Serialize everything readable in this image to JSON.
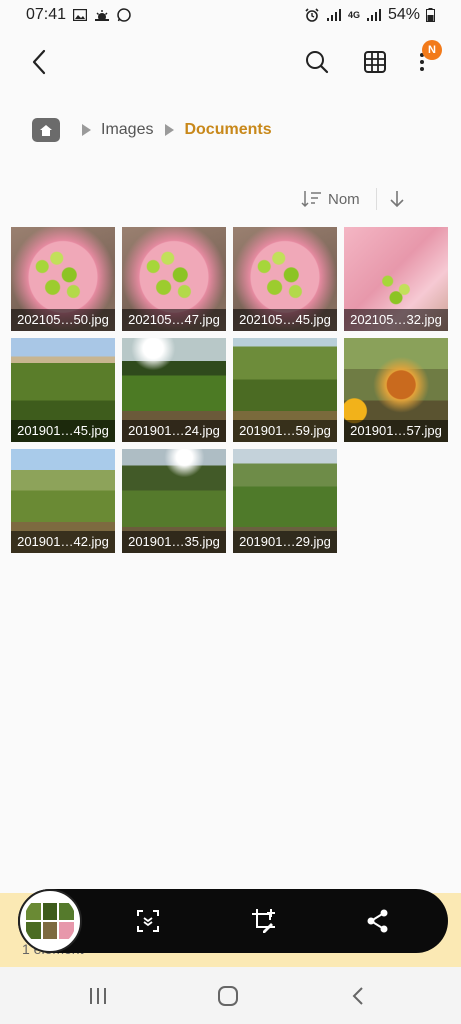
{
  "status_bar": {
    "time": "07:41",
    "battery": "54%",
    "network": "4G"
  },
  "app_bar": {
    "notification_badge": "N"
  },
  "breadcrumb": {
    "items": [
      "Images",
      "Documents"
    ]
  },
  "sort": {
    "label": "Nom"
  },
  "files": [
    {
      "name": "202105…50.jpg"
    },
    {
      "name": "202105…47.jpg"
    },
    {
      "name": "202105…45.jpg"
    },
    {
      "name": "202105…32.jpg"
    },
    {
      "name": "201901…45.jpg"
    },
    {
      "name": "201901…24.jpg"
    },
    {
      "name": "201901…59.jpg"
    },
    {
      "name": "201901…57.jpg"
    },
    {
      "name": "201901…42.jpg"
    },
    {
      "name": "201901…35.jpg"
    },
    {
      "name": "201901…29.jpg"
    }
  ],
  "bottom": {
    "selection_label": "1 élément"
  },
  "colors": {
    "accent": "#c8881a",
    "badge": "#f27a1a",
    "strip": "#fbe9b4"
  }
}
